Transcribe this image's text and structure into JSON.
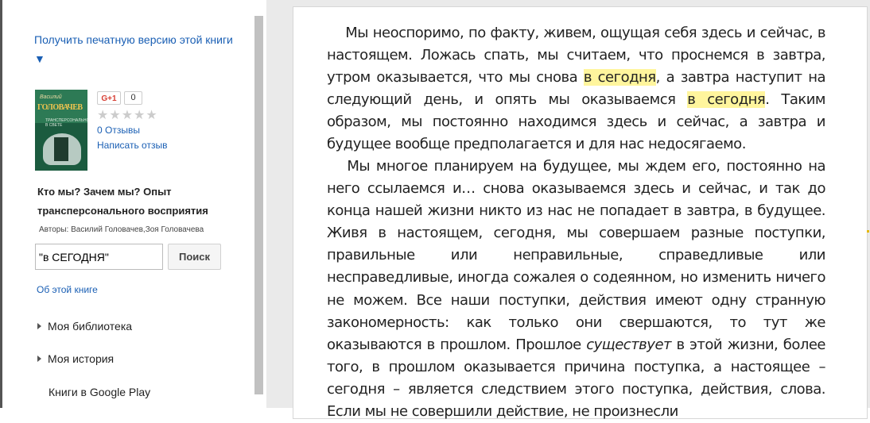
{
  "sidebar": {
    "print_version_link": "Получить печатную версию этой книги ▼",
    "cover": {
      "author_line": "Василий",
      "name_line": "ГОЛОВАЧЕВ",
      "sub_line": "ТРАНСПЕРСОНАЛЬНОЕ В СВЕТЕ"
    },
    "gplus_label": "G+1",
    "gplus_count": "0",
    "stars": "★★★★★",
    "reviews_link": "0 Отзывы",
    "write_review_link": "Написать отзыв",
    "book_title": "Кто мы? Зачем мы? Опыт трансперсонального восприятия",
    "authors": "Авторы: Василий Головачев,Зоя Головачева",
    "search": {
      "value": "\"в СЕГОДНЯ\"",
      "button_label": "Поиск"
    },
    "about_link": "Об этой книге",
    "nav": {
      "library": "Моя библиотека",
      "history": "Моя история",
      "play": "Книги в Google Play"
    }
  },
  "reader": {
    "p1_a": "Мы неоспоримо, по факту, живем, ощущая себя здесь и сейчас, в настоящем. Ложась спать, мы считаем, что проснемся в завтра, утром оказывается, что мы снова ",
    "p1_hl1": "в сегодня",
    "p1_b": ", а завтра наступит на следующий день, и опять мы оказываемся ",
    "p1_hl2": "в сегодня",
    "p1_c": ". Таким образом, мы постоянно находимся здесь и сейчас, а завтра и будущее вообще предполагается и для нас недосягаемо.",
    "p2_a": "Мы многое планируем на будущее, мы ждем его, постоянно на него ссылаемся и… снова оказываемся здесь и сейчас, и так до конца нашей жизни никто из нас не попадает в завтра, в будущее. Живя в настоящем, сегодня, мы совершаем разные поступки, правильные или неправильные, справедливые или несправедливые, иногда сожалея о содеянном, но изменить ничего не можем. Все наши поступки, действия имеют одну странную закономерность: как только они свершаются, то тут же оказываются в прошлом. Прошлое ",
    "p2_em": "существует",
    "p2_b": " в этой жизни, более того, в прошлом оказывается причина поступка, а настоящее – сегодня – является следствием этого поступка, действия, слова. Если мы не совершили действие, не произнесли"
  },
  "colors": {
    "link": "#1a5fb4",
    "highlight": "#fff59d",
    "reader_bg": "#eaeaea"
  }
}
